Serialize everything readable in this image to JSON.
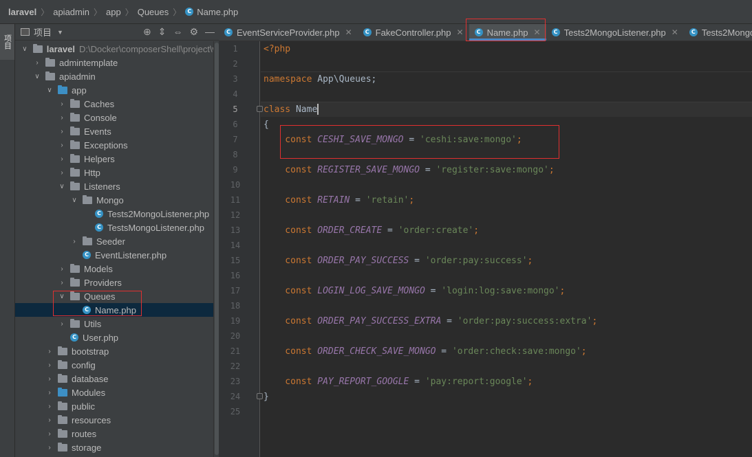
{
  "breadcrumb": [
    "laravel",
    "apiadmin",
    "app",
    "Queues",
    "Name.php"
  ],
  "leftstrip": {
    "tab_label": "项目"
  },
  "panel": {
    "title": "项目"
  },
  "tree": [
    {
      "label": "laravel",
      "path": "D:\\Docker\\composerShell\\project\\w",
      "kind": "folder",
      "open": true,
      "depth": 0
    },
    {
      "label": "admintemplate",
      "kind": "folder",
      "open": false,
      "depth": 1
    },
    {
      "label": "apiadmin",
      "kind": "folder",
      "open": true,
      "depth": 1
    },
    {
      "label": "app",
      "kind": "folder-blue",
      "open": true,
      "depth": 2
    },
    {
      "label": "Caches",
      "kind": "folder",
      "open": false,
      "depth": 3
    },
    {
      "label": "Console",
      "kind": "folder",
      "open": false,
      "depth": 3
    },
    {
      "label": "Events",
      "kind": "folder",
      "open": false,
      "depth": 3
    },
    {
      "label": "Exceptions",
      "kind": "folder",
      "open": false,
      "depth": 3
    },
    {
      "label": "Helpers",
      "kind": "folder",
      "open": false,
      "depth": 3
    },
    {
      "label": "Http",
      "kind": "folder",
      "open": false,
      "depth": 3
    },
    {
      "label": "Listeners",
      "kind": "folder",
      "open": true,
      "depth": 3
    },
    {
      "label": "Mongo",
      "kind": "folder",
      "open": true,
      "depth": 4
    },
    {
      "label": "Tests2MongoListener.php",
      "kind": "php",
      "depth": 5
    },
    {
      "label": "TestsMongoListener.php",
      "kind": "php",
      "depth": 5
    },
    {
      "label": "Seeder",
      "kind": "folder",
      "open": false,
      "depth": 4
    },
    {
      "label": "EventListener.php",
      "kind": "php",
      "depth": 4
    },
    {
      "label": "Models",
      "kind": "folder",
      "open": false,
      "depth": 3
    },
    {
      "label": "Providers",
      "kind": "folder",
      "open": false,
      "depth": 3
    },
    {
      "label": "Queues",
      "kind": "folder",
      "open": true,
      "depth": 3
    },
    {
      "label": "Name.php",
      "kind": "php",
      "depth": 4,
      "selected": true
    },
    {
      "label": "Utils",
      "kind": "folder",
      "open": false,
      "depth": 3
    },
    {
      "label": "User.php",
      "kind": "php",
      "depth": 3
    },
    {
      "label": "bootstrap",
      "kind": "folder",
      "open": false,
      "depth": 2
    },
    {
      "label": "config",
      "kind": "folder",
      "open": false,
      "depth": 2
    },
    {
      "label": "database",
      "kind": "folder",
      "open": false,
      "depth": 2
    },
    {
      "label": "Modules",
      "kind": "folder-blue",
      "open": false,
      "depth": 2
    },
    {
      "label": "public",
      "kind": "folder",
      "open": false,
      "depth": 2
    },
    {
      "label": "resources",
      "kind": "folder",
      "open": false,
      "depth": 2
    },
    {
      "label": "routes",
      "kind": "folder",
      "open": false,
      "depth": 2
    },
    {
      "label": "storage",
      "kind": "folder",
      "open": false,
      "depth": 2
    }
  ],
  "tabs": [
    {
      "label": "EventServiceProvider.php",
      "active": false,
      "closable": true
    },
    {
      "label": "FakeController.php",
      "active": false,
      "closable": true
    },
    {
      "label": "Name.php",
      "active": true,
      "closable": true
    },
    {
      "label": "Tests2MongoListener.php",
      "active": false,
      "closable": true
    },
    {
      "label": "Tests2Mongo",
      "active": false,
      "closable": false
    }
  ],
  "editor": {
    "current_line": 5,
    "lines": [
      [
        {
          "t": "<?php",
          "c": "kw"
        }
      ],
      [],
      [
        {
          "t": "namespace ",
          "c": "kw"
        },
        {
          "t": "App\\Queues;",
          "c": "cls"
        }
      ],
      [],
      [
        {
          "t": "class ",
          "c": "kw"
        },
        {
          "t": "Name",
          "c": "cls"
        }
      ],
      [
        {
          "t": "{",
          "c": "cls"
        }
      ],
      [
        {
          "t": "    const ",
          "c": "kw"
        },
        {
          "t": "CESHI_SAVE_MONGO",
          "c": "cn"
        },
        {
          "t": " = ",
          "c": "cls"
        },
        {
          "t": "'ceshi:save:mongo'",
          "c": "str"
        },
        {
          "t": ";",
          "c": "kw"
        }
      ],
      [],
      [
        {
          "t": "    const ",
          "c": "kw"
        },
        {
          "t": "REGISTER_SAVE_MONGO",
          "c": "cn"
        },
        {
          "t": " = ",
          "c": "cls"
        },
        {
          "t": "'register:save:mongo'",
          "c": "str"
        },
        {
          "t": ";",
          "c": "kw"
        }
      ],
      [],
      [
        {
          "t": "    const ",
          "c": "kw"
        },
        {
          "t": "RETAIN",
          "c": "cn"
        },
        {
          "t": " = ",
          "c": "cls"
        },
        {
          "t": "'retain'",
          "c": "str"
        },
        {
          "t": ";",
          "c": "kw"
        }
      ],
      [],
      [
        {
          "t": "    const ",
          "c": "kw"
        },
        {
          "t": "ORDER_CREATE",
          "c": "cn"
        },
        {
          "t": " = ",
          "c": "cls"
        },
        {
          "t": "'order:create'",
          "c": "str"
        },
        {
          "t": ";",
          "c": "kw"
        }
      ],
      [],
      [
        {
          "t": "    const ",
          "c": "kw"
        },
        {
          "t": "ORDER_PAY_SUCCESS",
          "c": "cn"
        },
        {
          "t": " = ",
          "c": "cls"
        },
        {
          "t": "'order:pay:success'",
          "c": "str"
        },
        {
          "t": ";",
          "c": "kw"
        }
      ],
      [],
      [
        {
          "t": "    const ",
          "c": "kw"
        },
        {
          "t": "LOGIN_LOG_SAVE_MONGO",
          "c": "cn"
        },
        {
          "t": " = ",
          "c": "cls"
        },
        {
          "t": "'login:log:save:mongo'",
          "c": "str"
        },
        {
          "t": ";",
          "c": "kw"
        }
      ],
      [],
      [
        {
          "t": "    const ",
          "c": "kw"
        },
        {
          "t": "ORDER_PAY_SUCCESS_EXTRA",
          "c": "cn"
        },
        {
          "t": " = ",
          "c": "cls"
        },
        {
          "t": "'order:pay:success:extra'",
          "c": "str"
        },
        {
          "t": ";",
          "c": "kw"
        }
      ],
      [],
      [
        {
          "t": "    const ",
          "c": "kw"
        },
        {
          "t": "ORDER_CHECK_SAVE_MONGO",
          "c": "cn"
        },
        {
          "t": " = ",
          "c": "cls"
        },
        {
          "t": "'order:check:save:mongo'",
          "c": "str"
        },
        {
          "t": ";",
          "c": "kw"
        }
      ],
      [],
      [
        {
          "t": "    const ",
          "c": "kw"
        },
        {
          "t": "PAY_REPORT_GOOGLE",
          "c": "cn"
        },
        {
          "t": " = ",
          "c": "cls"
        },
        {
          "t": "'pay:report:google'",
          "c": "str"
        },
        {
          "t": ";",
          "c": "kw"
        }
      ],
      [
        {
          "t": "}",
          "c": "cls"
        }
      ],
      []
    ]
  },
  "colors": {
    "highlight_box": "#e03030",
    "accent": "#4a88c7",
    "selection": "#0d293e"
  }
}
